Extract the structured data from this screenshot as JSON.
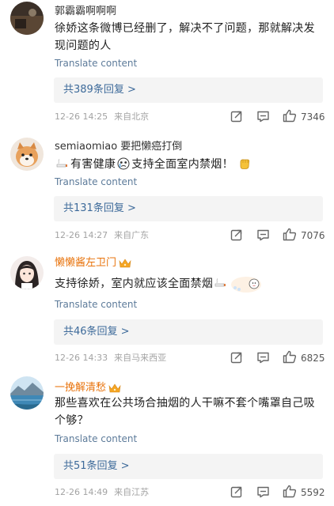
{
  "comments": [
    {
      "username": "郭霸霸啊啊啊",
      "username_color": "#333333",
      "has_badge": false,
      "text": "徐娇这条微博已经删了，解决不了问题，那就解决发现问题的人",
      "translate": "Translate content",
      "replies": "共389条回复 >",
      "date": "12-26 14:25",
      "location": "来自北京",
      "likes": "7346",
      "avatar_icon": "dark-landscape-avatar"
    },
    {
      "username": "semiaomiao 要把懒癌打倒",
      "username_color": "#333333",
      "has_badge": false,
      "text_parts": [
        "有害健康",
        "支持全面室内禁烟！"
      ],
      "emojis": [
        "no-smoking-emoji",
        "crying-face-emoji",
        "fist-emoji"
      ],
      "translate": "Translate content",
      "replies": "共131条回复 >",
      "date": "12-26 14:27",
      "location": "来自广东",
      "likes": "7076",
      "avatar_icon": "shiba-dog-avatar"
    },
    {
      "username": "懒懒酱左卫门",
      "username_color": "#e8730c",
      "has_badge": true,
      "text": "支持徐娇，室内就应该全面禁烟",
      "emojis": [
        "no-smoking-emoji",
        "cartoon-sticker-emoji"
      ],
      "translate": "Translate content",
      "replies": "共46条回复 >",
      "date": "12-26 14:33",
      "location": "来自马来西亚",
      "likes": "6825",
      "avatar_icon": "anime-girl-avatar"
    },
    {
      "username": "一挽解清愁",
      "username_color": "#e8730c",
      "has_badge": true,
      "text": "那些喜欢在公共场合抽烟的人干嘛不套个嘴罩自己吸个够？",
      "translate": "Translate content",
      "replies": "共51条回复 >",
      "date": "12-26 14:49",
      "location": "来自江苏",
      "likes": "5592",
      "avatar_icon": "lake-landscape-avatar"
    }
  ],
  "icons": {
    "forward": "forward-icon",
    "comment": "comment-icon",
    "like": "thumbs-up-icon"
  }
}
